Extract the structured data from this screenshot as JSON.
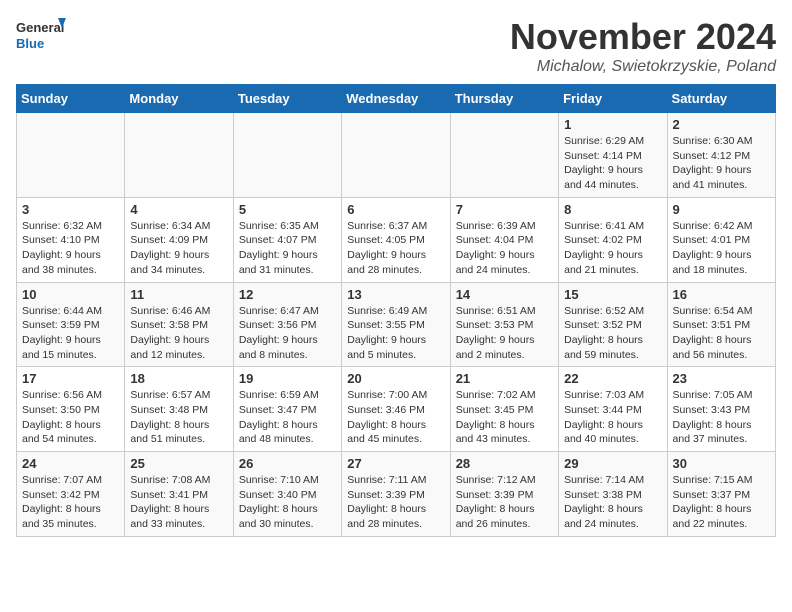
{
  "header": {
    "logo_line1": "General",
    "logo_line2": "Blue",
    "month": "November 2024",
    "location": "Michalow, Swietokrzyskie, Poland"
  },
  "weekdays": [
    "Sunday",
    "Monday",
    "Tuesday",
    "Wednesday",
    "Thursday",
    "Friday",
    "Saturday"
  ],
  "weeks": [
    [
      {
        "day": "",
        "sunrise": "",
        "sunset": "",
        "daylight": ""
      },
      {
        "day": "",
        "sunrise": "",
        "sunset": "",
        "daylight": ""
      },
      {
        "day": "",
        "sunrise": "",
        "sunset": "",
        "daylight": ""
      },
      {
        "day": "",
        "sunrise": "",
        "sunset": "",
        "daylight": ""
      },
      {
        "day": "",
        "sunrise": "",
        "sunset": "",
        "daylight": ""
      },
      {
        "day": "1",
        "sunrise": "Sunrise: 6:29 AM",
        "sunset": "Sunset: 4:14 PM",
        "daylight": "Daylight: 9 hours and 44 minutes."
      },
      {
        "day": "2",
        "sunrise": "Sunrise: 6:30 AM",
        "sunset": "Sunset: 4:12 PM",
        "daylight": "Daylight: 9 hours and 41 minutes."
      }
    ],
    [
      {
        "day": "3",
        "sunrise": "Sunrise: 6:32 AM",
        "sunset": "Sunset: 4:10 PM",
        "daylight": "Daylight: 9 hours and 38 minutes."
      },
      {
        "day": "4",
        "sunrise": "Sunrise: 6:34 AM",
        "sunset": "Sunset: 4:09 PM",
        "daylight": "Daylight: 9 hours and 34 minutes."
      },
      {
        "day": "5",
        "sunrise": "Sunrise: 6:35 AM",
        "sunset": "Sunset: 4:07 PM",
        "daylight": "Daylight: 9 hours and 31 minutes."
      },
      {
        "day": "6",
        "sunrise": "Sunrise: 6:37 AM",
        "sunset": "Sunset: 4:05 PM",
        "daylight": "Daylight: 9 hours and 28 minutes."
      },
      {
        "day": "7",
        "sunrise": "Sunrise: 6:39 AM",
        "sunset": "Sunset: 4:04 PM",
        "daylight": "Daylight: 9 hours and 24 minutes."
      },
      {
        "day": "8",
        "sunrise": "Sunrise: 6:41 AM",
        "sunset": "Sunset: 4:02 PM",
        "daylight": "Daylight: 9 hours and 21 minutes."
      },
      {
        "day": "9",
        "sunrise": "Sunrise: 6:42 AM",
        "sunset": "Sunset: 4:01 PM",
        "daylight": "Daylight: 9 hours and 18 minutes."
      }
    ],
    [
      {
        "day": "10",
        "sunrise": "Sunrise: 6:44 AM",
        "sunset": "Sunset: 3:59 PM",
        "daylight": "Daylight: 9 hours and 15 minutes."
      },
      {
        "day": "11",
        "sunrise": "Sunrise: 6:46 AM",
        "sunset": "Sunset: 3:58 PM",
        "daylight": "Daylight: 9 hours and 12 minutes."
      },
      {
        "day": "12",
        "sunrise": "Sunrise: 6:47 AM",
        "sunset": "Sunset: 3:56 PM",
        "daylight": "Daylight: 9 hours and 8 minutes."
      },
      {
        "day": "13",
        "sunrise": "Sunrise: 6:49 AM",
        "sunset": "Sunset: 3:55 PM",
        "daylight": "Daylight: 9 hours and 5 minutes."
      },
      {
        "day": "14",
        "sunrise": "Sunrise: 6:51 AM",
        "sunset": "Sunset: 3:53 PM",
        "daylight": "Daylight: 9 hours and 2 minutes."
      },
      {
        "day": "15",
        "sunrise": "Sunrise: 6:52 AM",
        "sunset": "Sunset: 3:52 PM",
        "daylight": "Daylight: 8 hours and 59 minutes."
      },
      {
        "day": "16",
        "sunrise": "Sunrise: 6:54 AM",
        "sunset": "Sunset: 3:51 PM",
        "daylight": "Daylight: 8 hours and 56 minutes."
      }
    ],
    [
      {
        "day": "17",
        "sunrise": "Sunrise: 6:56 AM",
        "sunset": "Sunset: 3:50 PM",
        "daylight": "Daylight: 8 hours and 54 minutes."
      },
      {
        "day": "18",
        "sunrise": "Sunrise: 6:57 AM",
        "sunset": "Sunset: 3:48 PM",
        "daylight": "Daylight: 8 hours and 51 minutes."
      },
      {
        "day": "19",
        "sunrise": "Sunrise: 6:59 AM",
        "sunset": "Sunset: 3:47 PM",
        "daylight": "Daylight: 8 hours and 48 minutes."
      },
      {
        "day": "20",
        "sunrise": "Sunrise: 7:00 AM",
        "sunset": "Sunset: 3:46 PM",
        "daylight": "Daylight: 8 hours and 45 minutes."
      },
      {
        "day": "21",
        "sunrise": "Sunrise: 7:02 AM",
        "sunset": "Sunset: 3:45 PM",
        "daylight": "Daylight: 8 hours and 43 minutes."
      },
      {
        "day": "22",
        "sunrise": "Sunrise: 7:03 AM",
        "sunset": "Sunset: 3:44 PM",
        "daylight": "Daylight: 8 hours and 40 minutes."
      },
      {
        "day": "23",
        "sunrise": "Sunrise: 7:05 AM",
        "sunset": "Sunset: 3:43 PM",
        "daylight": "Daylight: 8 hours and 37 minutes."
      }
    ],
    [
      {
        "day": "24",
        "sunrise": "Sunrise: 7:07 AM",
        "sunset": "Sunset: 3:42 PM",
        "daylight": "Daylight: 8 hours and 35 minutes."
      },
      {
        "day": "25",
        "sunrise": "Sunrise: 7:08 AM",
        "sunset": "Sunset: 3:41 PM",
        "daylight": "Daylight: 8 hours and 33 minutes."
      },
      {
        "day": "26",
        "sunrise": "Sunrise: 7:10 AM",
        "sunset": "Sunset: 3:40 PM",
        "daylight": "Daylight: 8 hours and 30 minutes."
      },
      {
        "day": "27",
        "sunrise": "Sunrise: 7:11 AM",
        "sunset": "Sunset: 3:39 PM",
        "daylight": "Daylight: 8 hours and 28 minutes."
      },
      {
        "day": "28",
        "sunrise": "Sunrise: 7:12 AM",
        "sunset": "Sunset: 3:39 PM",
        "daylight": "Daylight: 8 hours and 26 minutes."
      },
      {
        "day": "29",
        "sunrise": "Sunrise: 7:14 AM",
        "sunset": "Sunset: 3:38 PM",
        "daylight": "Daylight: 8 hours and 24 minutes."
      },
      {
        "day": "30",
        "sunrise": "Sunrise: 7:15 AM",
        "sunset": "Sunset: 3:37 PM",
        "daylight": "Daylight: 8 hours and 22 minutes."
      }
    ]
  ]
}
